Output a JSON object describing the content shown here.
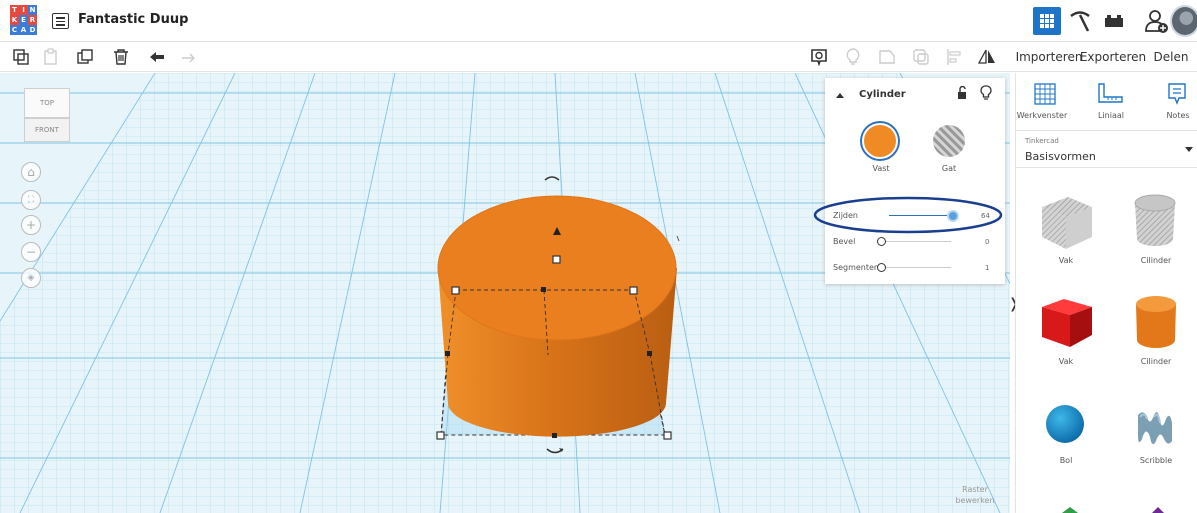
{
  "app": {
    "title": "Fantastic Duup",
    "logo_letters": [
      "T",
      "I",
      "N",
      "K",
      "E",
      "R",
      "C",
      "A",
      "D"
    ],
    "logo_colors": [
      "#e8483e",
      "#e8483e",
      "#3b7cd6",
      "#e8483e",
      "#3b7cd6",
      "#e8483e",
      "#3b7cd6",
      "#3b7cd6",
      "#3b7cd6"
    ]
  },
  "topbar": {
    "icons": [
      "3d-design-grid-icon",
      "pickaxe-icon",
      "bricks-icon",
      "add-user-icon",
      "avatar"
    ]
  },
  "toolbar": {
    "import_label": "Importeren",
    "export_label": "Exporteren",
    "share_label": "Delen"
  },
  "viewcube": {
    "top_label": "TOP",
    "front_label": "FRONT"
  },
  "shape_panel": {
    "title": "Cylinder",
    "solid_label": "Vast",
    "hole_label": "Gat",
    "sides_label": "Zijden",
    "sides_value": "64",
    "sides_fraction": 1.0,
    "bevel_label": "Bevel",
    "bevel_value": "0",
    "bevel_fraction": 0.0,
    "segments_label": "Segmenten",
    "segments_value": "1",
    "segments_fraction": 0.0
  },
  "sidebar": {
    "workplane_label": "Werkvenster",
    "ruler_label": "Liniaal",
    "notes_label": "Notes",
    "library_category": "Tinkercad",
    "library_name": "Basisvormen",
    "shapes": [
      {
        "label": "Vak"
      },
      {
        "label": "Cilinder"
      },
      {
        "label": "Vak"
      },
      {
        "label": "Cilinder"
      },
      {
        "label": "Bol"
      },
      {
        "label": "Scribble"
      }
    ]
  },
  "raster": {
    "line1": "Raster",
    "line2": "bewerken"
  },
  "colors": {
    "orange": "#ef8a24",
    "brand_blue": "#1e75c8",
    "grid": "#9fd3ea",
    "highlight": "#1b3f8f"
  }
}
